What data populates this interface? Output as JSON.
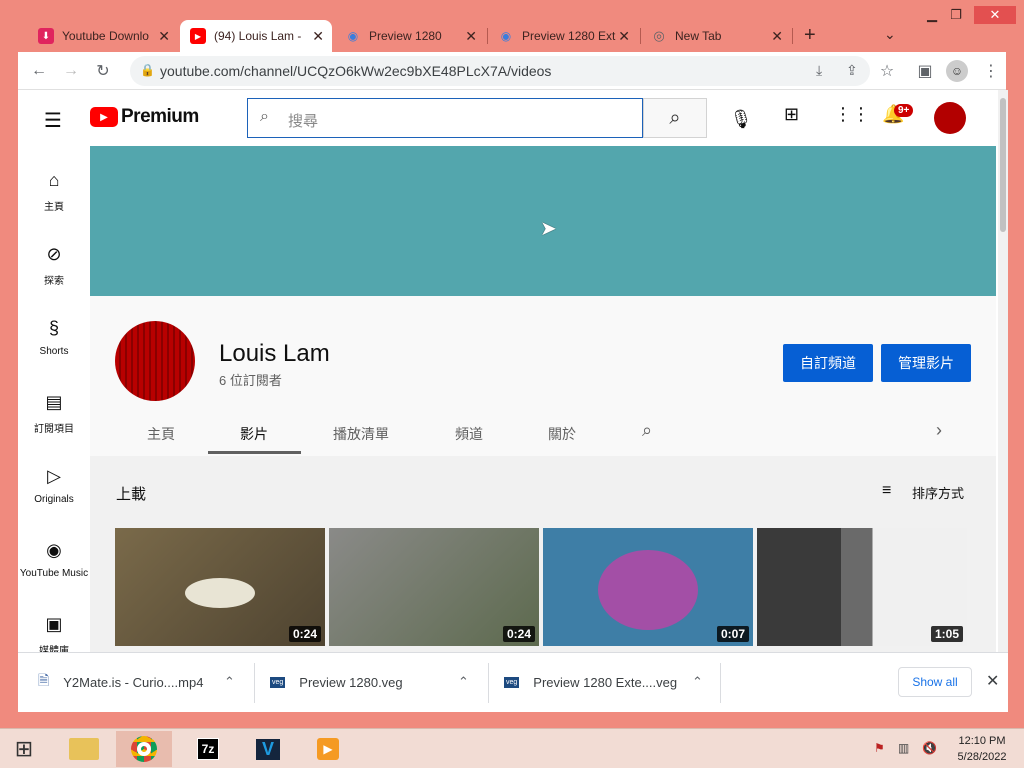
{
  "browser": {
    "tabs": [
      {
        "title": "Youtube Downlo",
        "icon": "download-icon",
        "color": "#e0245e"
      },
      {
        "title": "(94) Louis Lam -",
        "icon": "youtube-icon",
        "color": "#ff0000"
      },
      {
        "title": "Preview 1280",
        "icon": "tab-icon-blue",
        "color": "#3b7ddd"
      },
      {
        "title": "Preview 1280 Ext",
        "icon": "tab-icon-blue",
        "color": "#3b7ddd"
      },
      {
        "title": "New Tab",
        "icon": "chrome-icon",
        "color": "#5f6368"
      }
    ],
    "new_tab_label": "+",
    "url": "youtube.com/channel/UCQzO6kWw2ec9bXE48PLcX7A/videos"
  },
  "youtube": {
    "logo_text": "Premium",
    "search_placeholder": "搜尋",
    "notification_count": "9+",
    "sidebar": [
      {
        "label": "主頁",
        "icon": "home-icon"
      },
      {
        "label": "探索",
        "icon": "compass-icon"
      },
      {
        "label": "Shorts",
        "icon": "shorts-icon"
      },
      {
        "label": "訂閱項目",
        "icon": "subscriptions-icon"
      },
      {
        "label": "Originals",
        "icon": "originals-icon"
      },
      {
        "label": "YouTube Music",
        "icon": "music-icon"
      },
      {
        "label": "媒體庫",
        "icon": "library-icon"
      }
    ],
    "channel": {
      "name": "Louis Lam",
      "subscribers": "6 位訂閱者",
      "customize_label": "自訂頻道",
      "manage_label": "管理影片"
    },
    "channel_tabs": [
      "主頁",
      "影片",
      "播放清單",
      "頻道",
      "關於"
    ],
    "active_tab": "影片",
    "section_title": "上載",
    "sort_label": "排序方式",
    "videos": [
      {
        "duration": "0:24",
        "bg": "#6b5a3c"
      },
      {
        "duration": "0:24",
        "bg": "#6d7560"
      },
      {
        "duration": "0:07",
        "bg": "#3e7ea6"
      },
      {
        "duration": "1:05",
        "bg": "#4a4a4a"
      }
    ]
  },
  "downloads": {
    "items": [
      {
        "name": "Y2Mate.is - Curio....mp4",
        "icon": "file-icon"
      },
      {
        "name": "Preview 1280.veg",
        "icon": "veg-file-icon"
      },
      {
        "name": "Preview 1280 Exte....veg",
        "icon": "veg-file-icon"
      }
    ],
    "show_all_label": "Show all"
  },
  "taskbar": {
    "time": "12:10 PM",
    "date": "5/28/2022",
    "apps": [
      "file-explorer-icon",
      "chrome-icon",
      "7zip-icon",
      "vegas-icon",
      "media-player-icon"
    ]
  }
}
